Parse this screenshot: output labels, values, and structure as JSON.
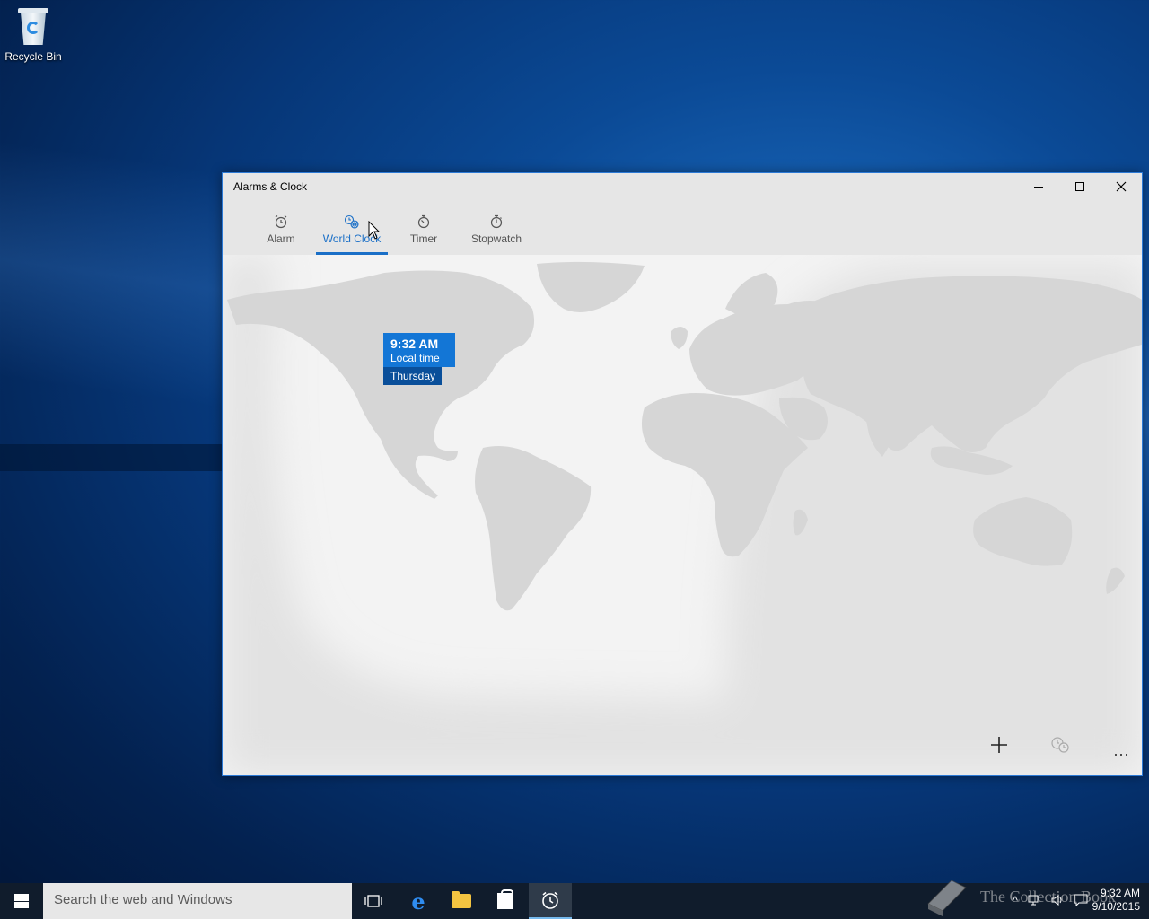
{
  "desktop": {
    "recycle_bin_label": "Recycle Bin"
  },
  "window": {
    "title": "Alarms & Clock",
    "controls": {
      "minimize": "minimize",
      "maximize": "maximize",
      "close": "close"
    }
  },
  "tabs": [
    {
      "label": "Alarm",
      "icon": "alarm-clock-icon",
      "active": false
    },
    {
      "label": "World Clock",
      "icon": "world-clock-icon",
      "active": true
    },
    {
      "label": "Timer",
      "icon": "timer-icon",
      "active": false
    },
    {
      "label": "Stopwatch",
      "icon": "stopwatch-icon",
      "active": false
    }
  ],
  "world_clock": {
    "local_pin": {
      "time": "9:32 AM",
      "caption": "Local time",
      "day": "Thursday"
    }
  },
  "bottom_bar": {
    "add": "+",
    "compare": "compare-icon",
    "more": "···"
  },
  "taskbar": {
    "search_placeholder": "Search the web and Windows",
    "apps": [
      "task-view",
      "edge",
      "file-explorer",
      "store",
      "alarms-clock"
    ],
    "clock_time": "9:32 AM",
    "clock_date": "9/10/2015"
  },
  "watermark": {
    "text": "The Collection Book"
  },
  "colors": {
    "accent": "#1a6fc7",
    "pin_bg": "#1376d6",
    "pin_day_bg": "#0a4f9a",
    "map_land": "#d6d6d6",
    "map_night": "#e2e2e2"
  }
}
